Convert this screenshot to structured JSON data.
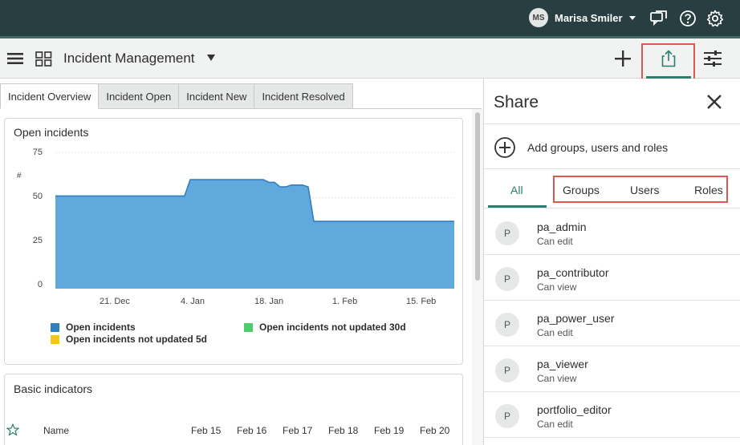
{
  "topbar": {
    "user_initials": "MS",
    "user_name": "Marisa Smiler",
    "icons": [
      "chat-icon",
      "help-icon",
      "gear-icon"
    ]
  },
  "header": {
    "title": "Incident Management",
    "icons": [
      "menu-icon",
      "grid-icon",
      "plus-icon",
      "share-icon",
      "filter-sliders-icon"
    ]
  },
  "tabs": [
    {
      "label": "Incident Overview",
      "active": true
    },
    {
      "label": "Incident Open",
      "active": false
    },
    {
      "label": "Incident New",
      "active": false
    },
    {
      "label": "Incident Resolved",
      "active": false
    }
  ],
  "open_incidents_card": {
    "title": "Open incidents",
    "y_unit": "#"
  },
  "chart_data": {
    "type": "area",
    "title": "Open incidents",
    "ylabel": "#",
    "ylim": [
      0,
      75
    ],
    "y_ticks": [
      0,
      25,
      50,
      75
    ],
    "x_ticks": [
      "21. Dec",
      "4. Jan",
      "18. Jan",
      "1. Feb",
      "15. Feb"
    ],
    "series": [
      {
        "name": "Open incidents",
        "color": "#61a9dc",
        "points": [
          [
            "2023-12-12",
            51
          ],
          [
            "2024-01-04",
            51
          ],
          [
            "2024-01-05",
            60
          ],
          [
            "2024-01-18",
            60
          ],
          [
            "2024-01-19",
            58.5
          ],
          [
            "2024-01-20",
            58.5
          ],
          [
            "2024-01-21",
            56
          ],
          [
            "2024-01-22",
            56
          ],
          [
            "2024-01-23",
            57
          ],
          [
            "2024-01-25",
            57
          ],
          [
            "2024-01-26",
            56
          ],
          [
            "2024-01-27",
            37
          ],
          [
            "2024-02-21",
            37
          ]
        ]
      },
      {
        "name": "Open incidents not updated 30d",
        "color": "#4ccd6c",
        "points": []
      },
      {
        "name": "Open incidents not updated 5d",
        "color": "#f5c518",
        "points": []
      }
    ],
    "legend": "bottom"
  },
  "legend": {
    "items": [
      {
        "label": "Open incidents",
        "color": "#2f7fc1"
      },
      {
        "label": "Open incidents not updated 30d",
        "color": "#4ccd6c"
      },
      {
        "label": "Open incidents not updated 5d",
        "color": "#f5c518"
      }
    ]
  },
  "basic_indicators_card": {
    "title": "Basic indicators",
    "name_header": "Name",
    "date_headers": [
      "Feb 15",
      "Feb 16",
      "Feb 17",
      "Feb 18",
      "Feb 19",
      "Feb 20"
    ]
  },
  "share_panel": {
    "title": "Share",
    "add_label": "Add groups, users and roles",
    "tabs": [
      "All",
      "Groups",
      "Users",
      "Roles"
    ],
    "active_tab": "All",
    "entries": [
      {
        "initial": "P",
        "name": "pa_admin",
        "permission": "Can edit"
      },
      {
        "initial": "P",
        "name": "pa_contributor",
        "permission": "Can view"
      },
      {
        "initial": "P",
        "name": "pa_power_user",
        "permission": "Can edit"
      },
      {
        "initial": "P",
        "name": "pa_viewer",
        "permission": "Can view"
      },
      {
        "initial": "P",
        "name": "portfolio_editor",
        "permission": "Can edit"
      }
    ]
  }
}
